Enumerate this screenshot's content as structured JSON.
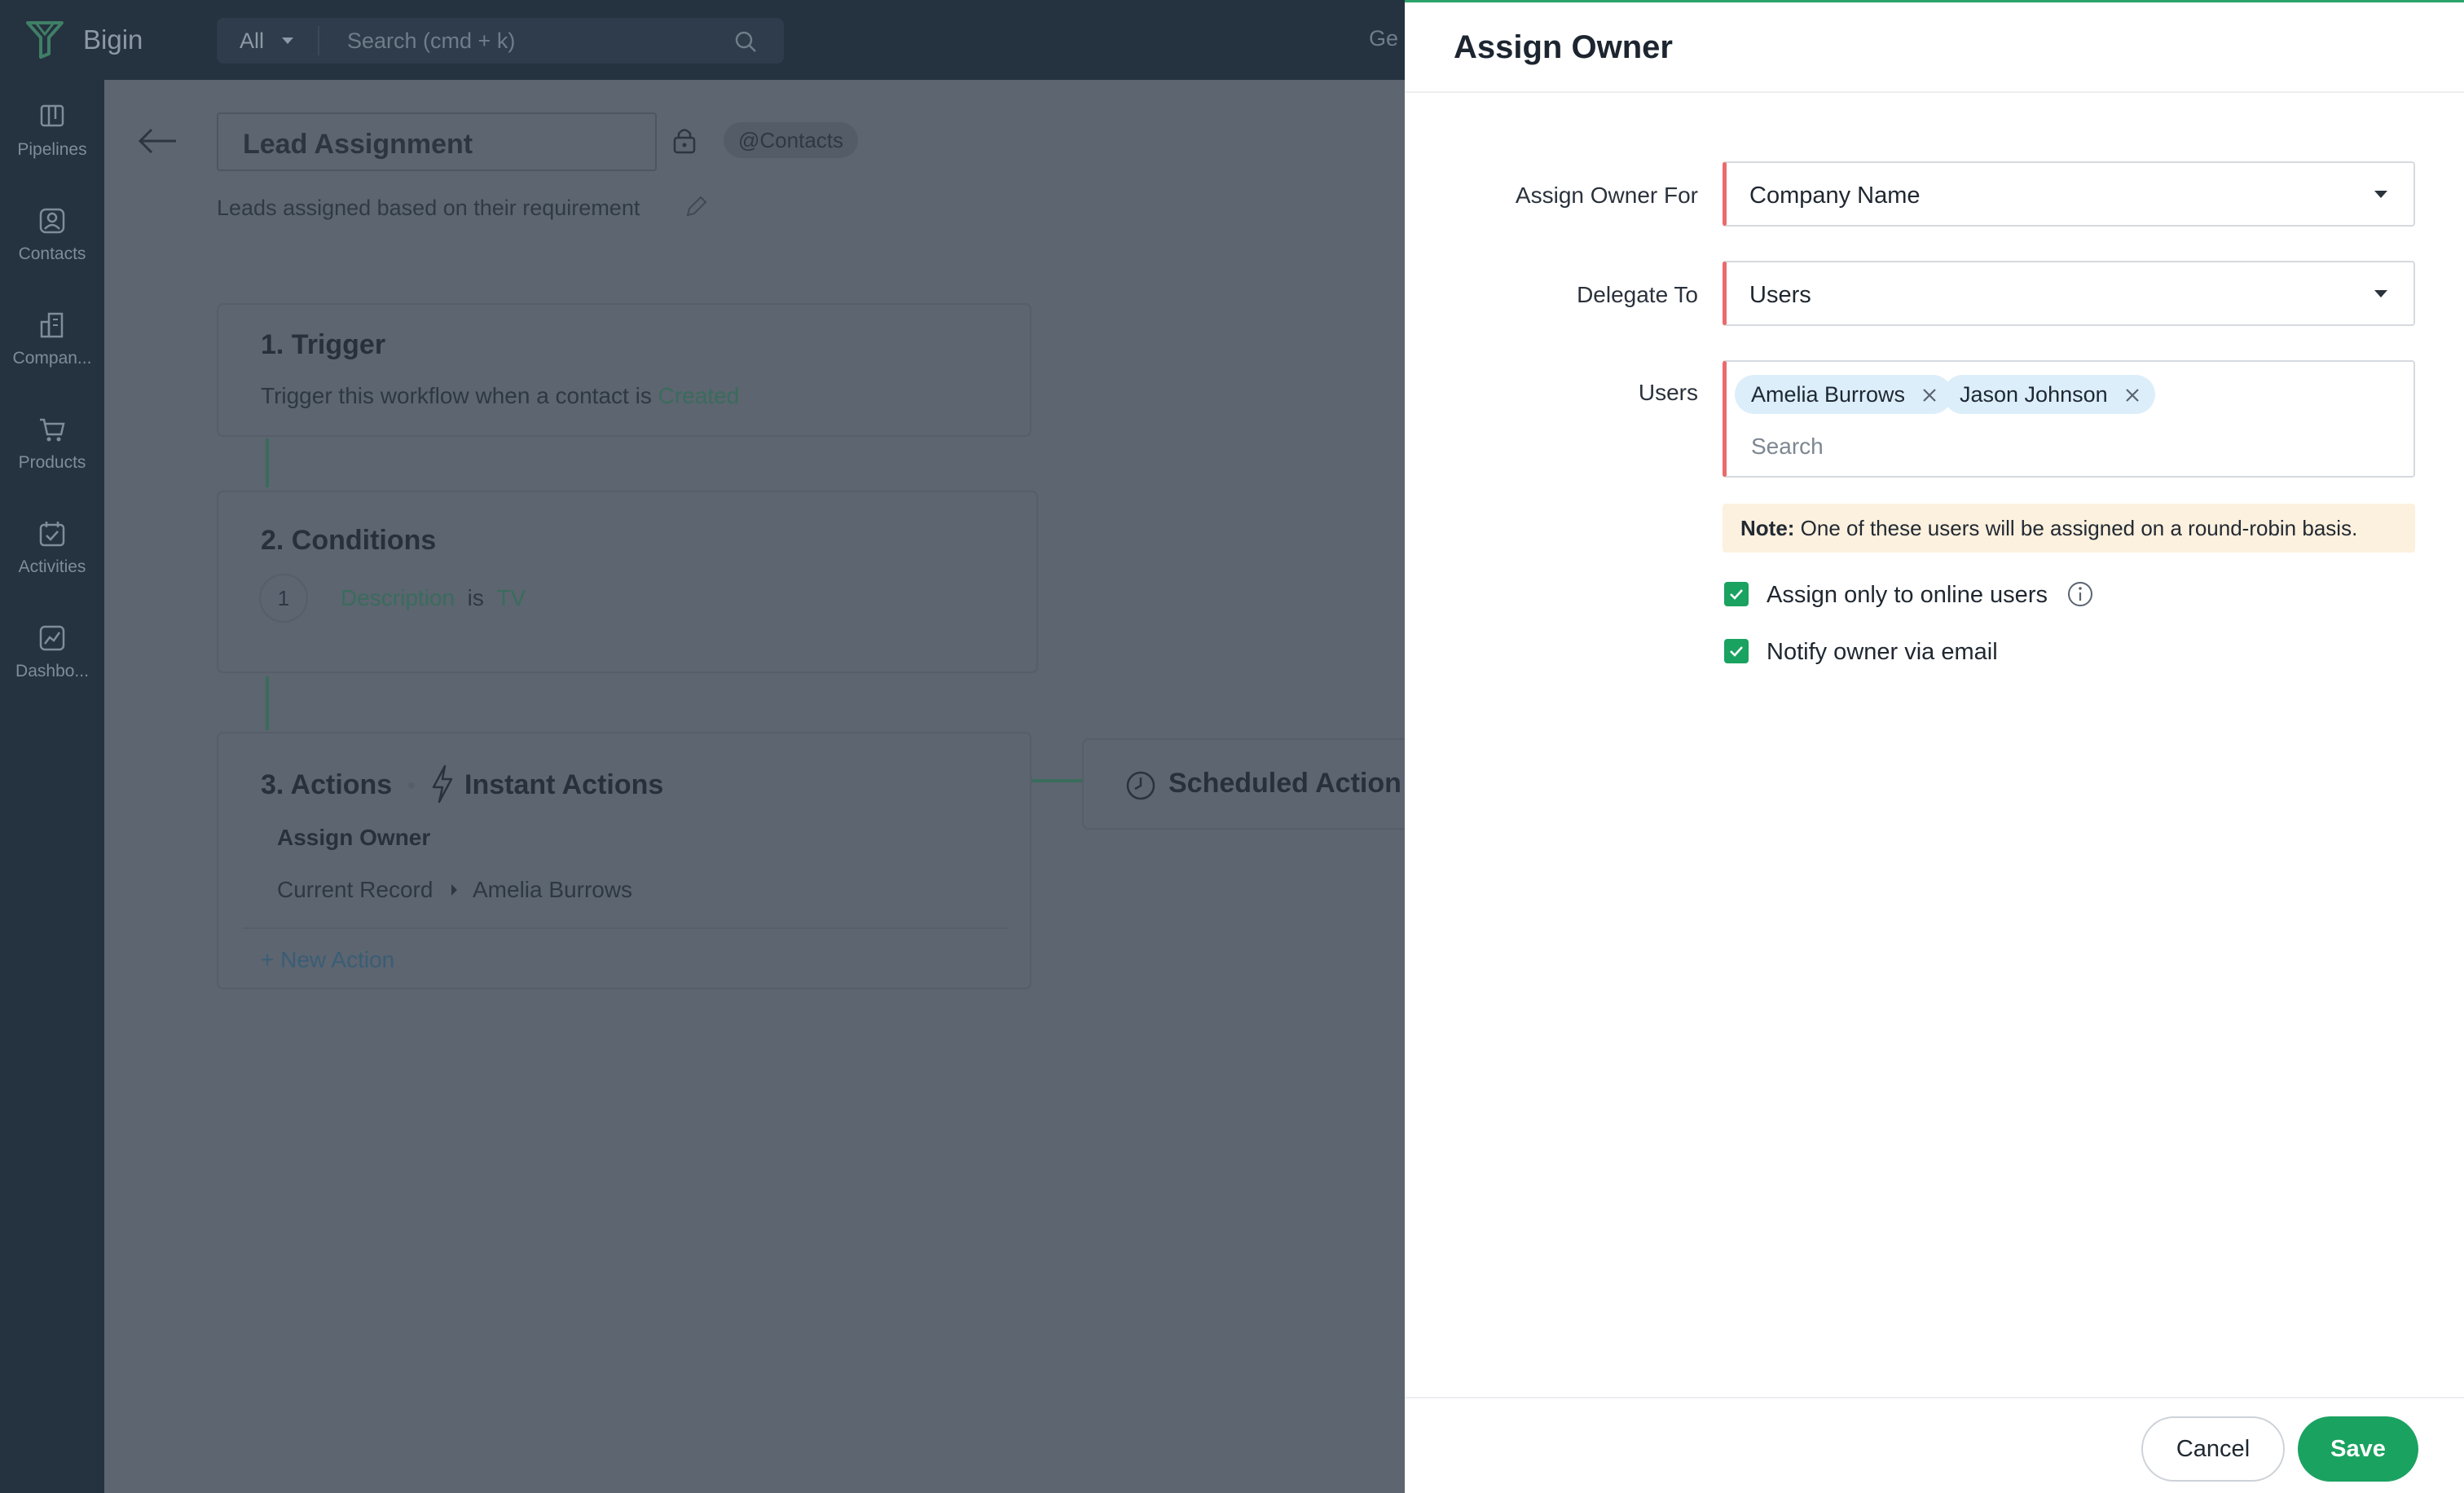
{
  "app": {
    "brand": "Bigin",
    "search_scope": "All",
    "search_placeholder": "Search (cmd + k)",
    "truncated_top_text": "Ge"
  },
  "sidebar": {
    "items": [
      {
        "label": "Pipelines",
        "icon": "pipelines-icon"
      },
      {
        "label": "Contacts",
        "icon": "contacts-icon"
      },
      {
        "label": "Compan...",
        "icon": "companies-icon"
      },
      {
        "label": "Products",
        "icon": "products-icon"
      },
      {
        "label": "Activities",
        "icon": "activities-icon"
      },
      {
        "label": "Dashbo...",
        "icon": "dashboard-icon"
      }
    ]
  },
  "workflow": {
    "name": "Lead Assignment",
    "module_tag": "@Contacts",
    "description": "Leads assigned based on their requirement",
    "trigger": {
      "title": "1. Trigger",
      "text": "Trigger this workflow when a contact is",
      "event": "Created"
    },
    "conditions": {
      "title": "2. Conditions",
      "number": "1",
      "field": "Description",
      "operator": "is",
      "value": "TV"
    },
    "actions": {
      "title": "3. Actions",
      "instant_label": "Instant Actions",
      "action_name": "Assign Owner",
      "record_label": "Current Record",
      "record_owner": "Amelia Burrows",
      "new_action": "New Action",
      "scheduled_label": "Scheduled Action"
    }
  },
  "panel": {
    "title": "Assign Owner",
    "assign_owner_for": {
      "label": "Assign Owner For",
      "value": "Company Name"
    },
    "delegate_to": {
      "label": "Delegate To",
      "value": "Users"
    },
    "users": {
      "label": "Users",
      "selected": [
        "Amelia Burrows",
        "Jason Johnson"
      ],
      "search_placeholder": "Search"
    },
    "note": {
      "prefix": "Note:",
      "text": "One of these users will be assigned on a round-robin basis."
    },
    "options": [
      {
        "label": "Assign only to online users",
        "checked": true
      },
      {
        "label": "Notify owner via email",
        "checked": true
      }
    ],
    "cancel_label": "Cancel",
    "save_label": "Save"
  },
  "colors": {
    "accent_green": "#1aa260",
    "required_red": "#ea6b6b",
    "chip_blue": "#dceefa",
    "note_bg": "#fcf0de"
  }
}
